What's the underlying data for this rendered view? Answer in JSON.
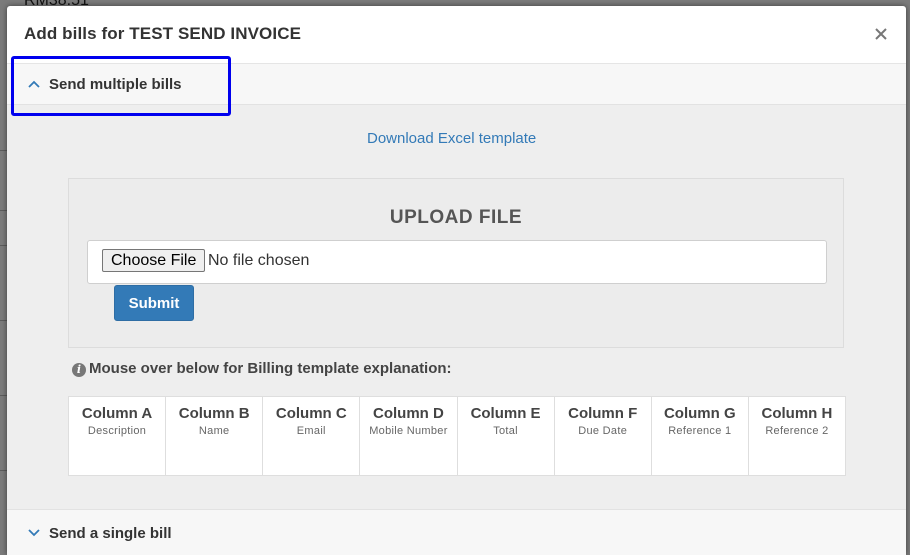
{
  "background": {
    "amount_text": "RM38.51"
  },
  "modal": {
    "title": "Add bills for TEST SEND INVOICE",
    "close_label": "×"
  },
  "multiple": {
    "section_label": "Send multiple bills",
    "download_link": "Download Excel template",
    "upload_title": "UPLOAD FILE",
    "choose_file_label": "Choose File",
    "no_file_text": "No file chosen",
    "submit_label": "Submit",
    "hint_text": "Mouse over below for Billing template explanation:",
    "columns": [
      {
        "name": "Column A",
        "desc": "Description"
      },
      {
        "name": "Column B",
        "desc": "Name"
      },
      {
        "name": "Column C",
        "desc": "Email"
      },
      {
        "name": "Column D",
        "desc": "Mobile Number"
      },
      {
        "name": "Column E",
        "desc": "Total"
      },
      {
        "name": "Column F",
        "desc": "Due Date"
      },
      {
        "name": "Column G",
        "desc": "Reference 1"
      },
      {
        "name": "Column H",
        "desc": "Reference 2"
      }
    ]
  },
  "single": {
    "section_label": "Send a single bill"
  },
  "colors": {
    "primary": "#337ab7",
    "highlight": "#0000ee"
  }
}
